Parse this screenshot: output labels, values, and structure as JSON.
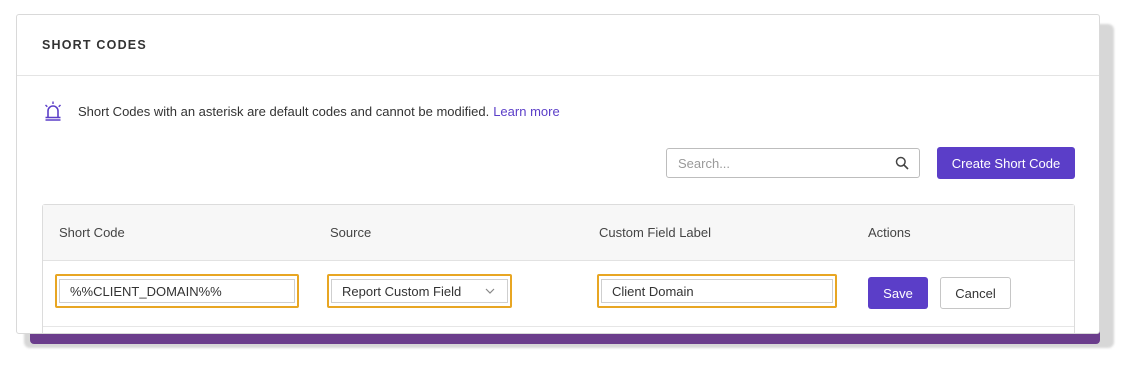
{
  "header": {
    "title": "SHORT CODES"
  },
  "notice": {
    "icon": "alarm-icon",
    "text": "Short Codes with an asterisk are default codes and cannot be modified.",
    "link": "Learn more"
  },
  "toolbar": {
    "search_placeholder": "Search...",
    "create_label": "Create Short Code"
  },
  "table": {
    "columns": [
      "Short Code",
      "Source",
      "Custom Field Label",
      "Actions"
    ],
    "edit_row": {
      "short_code": "%%CLIENT_DOMAIN%%",
      "source": "Report Custom Field",
      "custom_field_label": "Client Domain",
      "save_label": "Save",
      "cancel_label": "Cancel"
    }
  },
  "colors": {
    "accent": "#5b3ec8",
    "highlight": "#e8a623",
    "shadow": "#6b3d8c"
  }
}
